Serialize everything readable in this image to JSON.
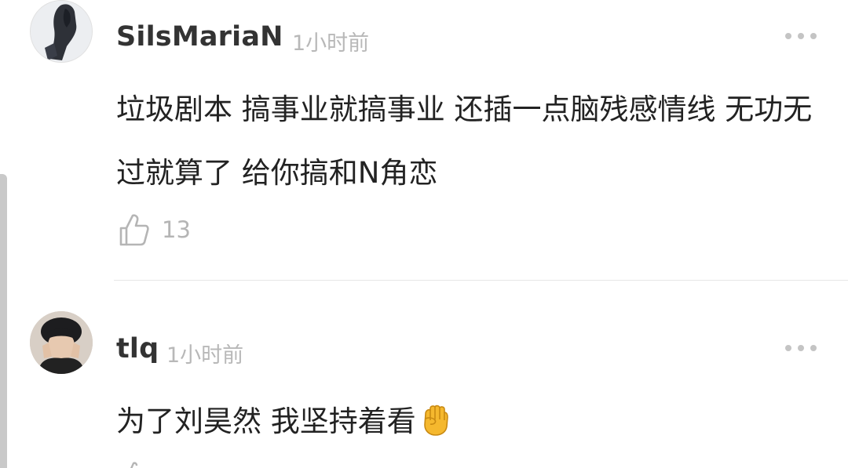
{
  "comments": [
    {
      "username": "SilsMariaN",
      "time": "1小时前",
      "text": "垃圾剧本 搞事业就搞事业 还插一点脑残感情线 无功无过就算了 给你搞和N角恋",
      "likes": "13",
      "avatar_icon": "avatar-image",
      "more_icon": "more-icon",
      "like_icon": "thumbs-up-icon"
    },
    {
      "username": "tlq",
      "time": "1小时前",
      "text": "为了刘昊然  我坚持着看",
      "emoji_icon": "raised-fist-emoji-icon",
      "avatar_icon": "avatar-image",
      "more_icon": "more-icon"
    }
  ],
  "colors": {
    "username": "#333333",
    "time": "#b8b8b8",
    "text": "#222222",
    "divider": "#e6e6e6",
    "emoji": "#f5b82e"
  }
}
